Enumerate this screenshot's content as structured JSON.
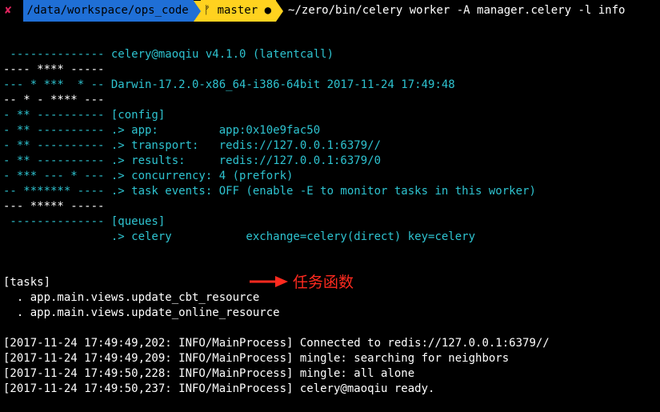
{
  "prompt": {
    "status_symbol": "✘",
    "cwd": "/data/workspace/ops_code",
    "branch_icon": "git-branch-icon",
    "branch": "master",
    "dirty_indicator": "●",
    "command": "~/zero/bin/celery worker -A manager.celery -l info",
    "colors": {
      "path_bg": "#1f6fd6",
      "git_bg": "#ffd21f",
      "error": "#e0245e"
    }
  },
  "banner": [
    " -------------- celery@maoqiu v4.1.0 (latentcall)",
    "---- **** -----",
    "--- * ***  * -- Darwin-17.2.0-x86_64-i386-64bit 2017-11-24 17:49:48",
    "-- * - **** ---",
    "- ** ---------- [config]",
    "- ** ---------- .> app:         app:0x10e9fac50",
    "- ** ---------- .> transport:   redis://127.0.0.1:6379//",
    "- ** ---------- .> results:     redis://127.0.0.1:6379/0",
    "- *** --- * --- .> concurrency: 4 (prefork)",
    "-- ******* ---- .> task events: OFF (enable -E to monitor tasks in this worker)",
    "--- ***** -----",
    " -------------- [queues]",
    "                .> celery           exchange=celery(direct) key=celery"
  ],
  "tasks_header": "[tasks]",
  "tasks": [
    "  . app.main.views.update_cbt_resource",
    "  . app.main.views.update_online_resource"
  ],
  "logs": [
    "[2017-11-24 17:49:49,202: INFO/MainProcess] Connected to redis://127.0.0.1:6379//",
    "[2017-11-24 17:49:49,209: INFO/MainProcess] mingle: searching for neighbors",
    "[2017-11-24 17:49:50,228: INFO/MainProcess] mingle: all alone",
    "[2017-11-24 17:49:50,237: INFO/MainProcess] celery@maoqiu ready."
  ],
  "annotation": {
    "label": "任务函数",
    "color": "#ff2a1f"
  },
  "colors": {
    "banner": "#2ec3d0",
    "text": "#ffffff",
    "background": "#000000"
  }
}
